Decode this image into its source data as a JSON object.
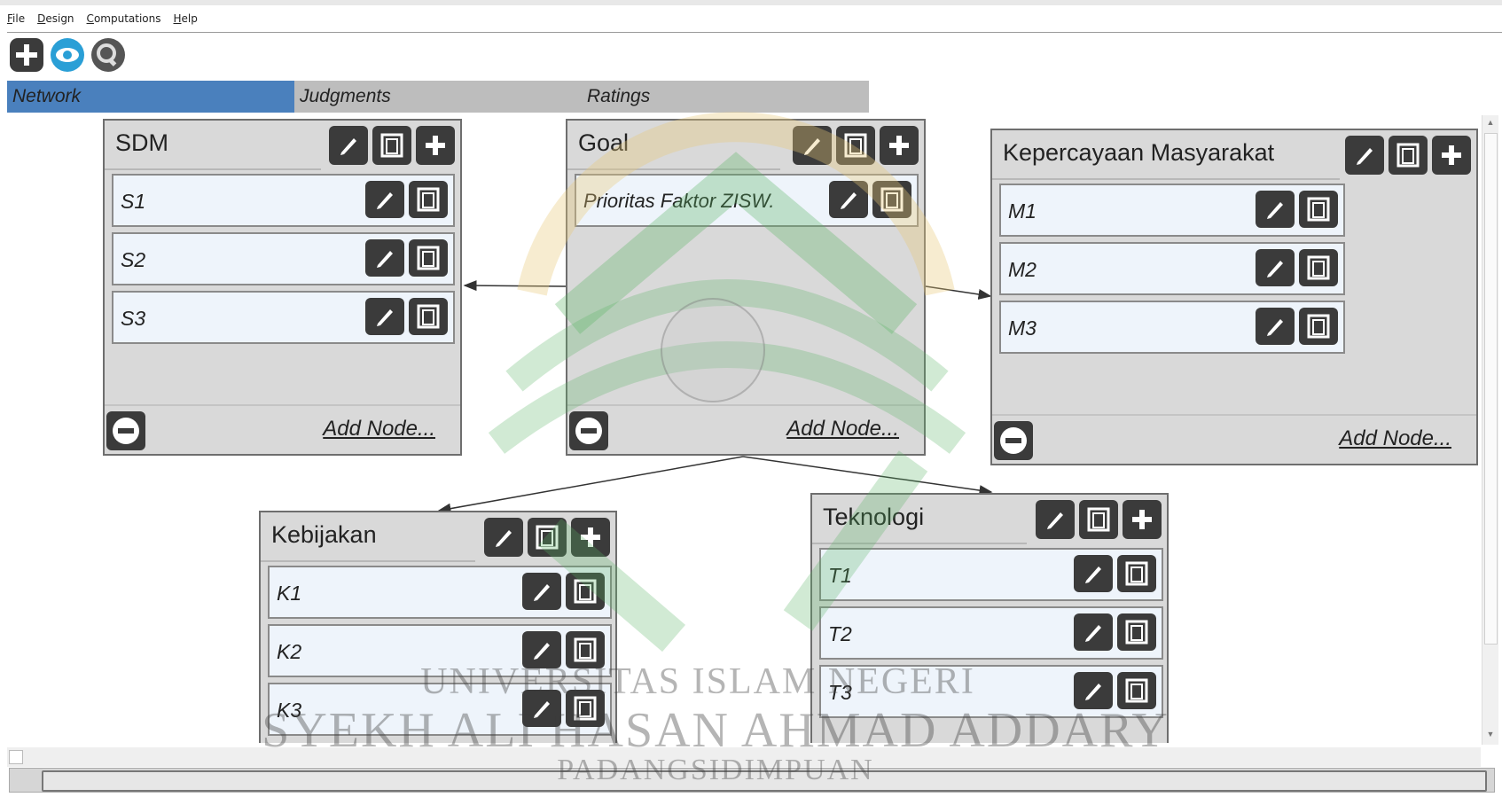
{
  "menu": {
    "file": "File",
    "design": "Design",
    "computations": "Computations",
    "help": "Help"
  },
  "toolbar": {
    "icons": [
      "plus-icon",
      "eye-icon",
      "magnifier-icon"
    ]
  },
  "tabs": {
    "network": "Network",
    "judgments": "Judgments",
    "ratings": "Ratings"
  },
  "clusters": {
    "sdm": {
      "title": "SDM",
      "nodes": [
        "S1",
        "S2",
        "S3"
      ],
      "add": "Add Node..."
    },
    "goal": {
      "title": "Goal",
      "nodes": [
        "Prioritas Faktor ZISW."
      ],
      "add": "Add Node..."
    },
    "masyarakat": {
      "title": "Kepercayaan Masyarakat",
      "nodes": [
        "M1",
        "M2",
        "M3"
      ],
      "add": "Add Node..."
    },
    "kebijakan": {
      "title": "Kebijakan",
      "nodes": [
        "K1",
        "K2",
        "K3"
      ]
    },
    "teknologi": {
      "title": "Teknologi",
      "nodes": [
        "T1",
        "T2",
        "T3"
      ]
    }
  },
  "watermark": {
    "line1": "UNIVERSITAS ISLAM NEGERI",
    "line2": "SYEKH ALI HASAN AHMAD ADDARY",
    "line3": "PADANGSIDIMPUAN"
  },
  "colors": {
    "active_tab": "#4a80bd",
    "cluster_bg": "#d9d9d9",
    "node_bg": "#eef4fb",
    "button_bg": "#3b3b3b"
  }
}
